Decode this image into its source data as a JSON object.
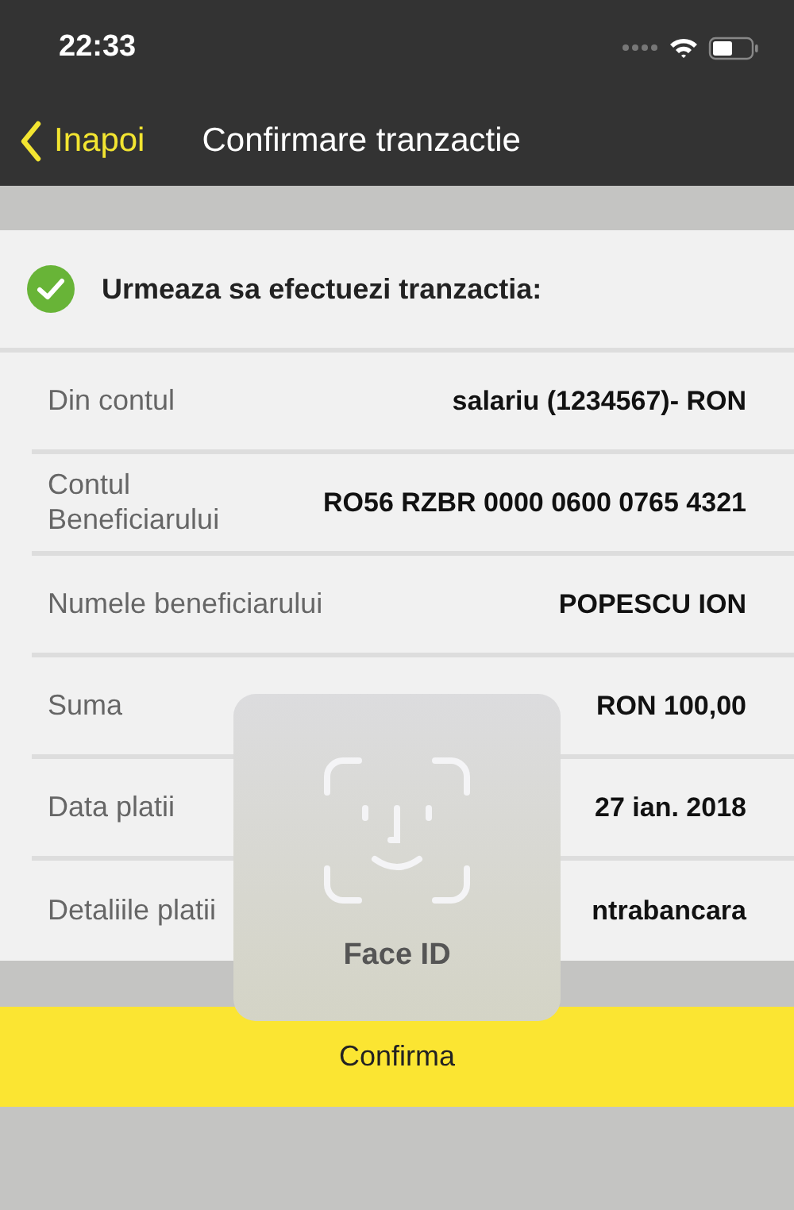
{
  "status_bar": {
    "time": "22:33"
  },
  "nav": {
    "back": "Inapoi",
    "title": "Confirmare tranzactie"
  },
  "header": {
    "text": "Urmeaza sa efectuezi tranzactia:"
  },
  "rows": [
    {
      "label": "Din contul",
      "value": "salariu (1234567)- RON"
    },
    {
      "label": "Contul Beneficiarului",
      "value": "RO56 RZBR 0000 0600 0765 4321"
    },
    {
      "label": "Numele beneficiarului",
      "value": "POPESCU ION"
    },
    {
      "label": "Suma",
      "value": "RON 100,00"
    },
    {
      "label": "Data platii",
      "value": "27 ian. 2018"
    },
    {
      "label": "Detaliile platii",
      "value": "ntrabancara"
    }
  ],
  "confirm_button": "Confirma",
  "face_id": {
    "label": "Face ID"
  }
}
